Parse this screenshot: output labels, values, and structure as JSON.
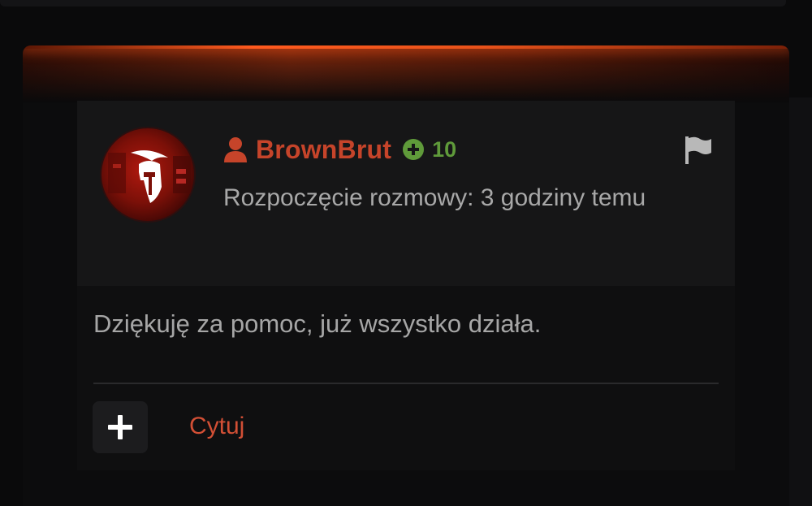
{
  "post": {
    "author": "BrownBrut",
    "reputation": "10",
    "meta": "Rozpoczęcie rozmowy: 3 godziny temu",
    "message": "Dziękuję za pomoc, już wszystko działa.",
    "quote_label": "Cytuj"
  },
  "icons": {
    "user": "user-icon",
    "reputation": "plus-circle-icon",
    "report": "flag-icon",
    "react": "plus-icon",
    "avatar": "spartan-helmet-icon"
  },
  "colors": {
    "accent_red": "#c6442a",
    "link_red": "#d24f35",
    "reputation_green": "#5f9a3a",
    "glow_orange": "#ff5a1e"
  }
}
